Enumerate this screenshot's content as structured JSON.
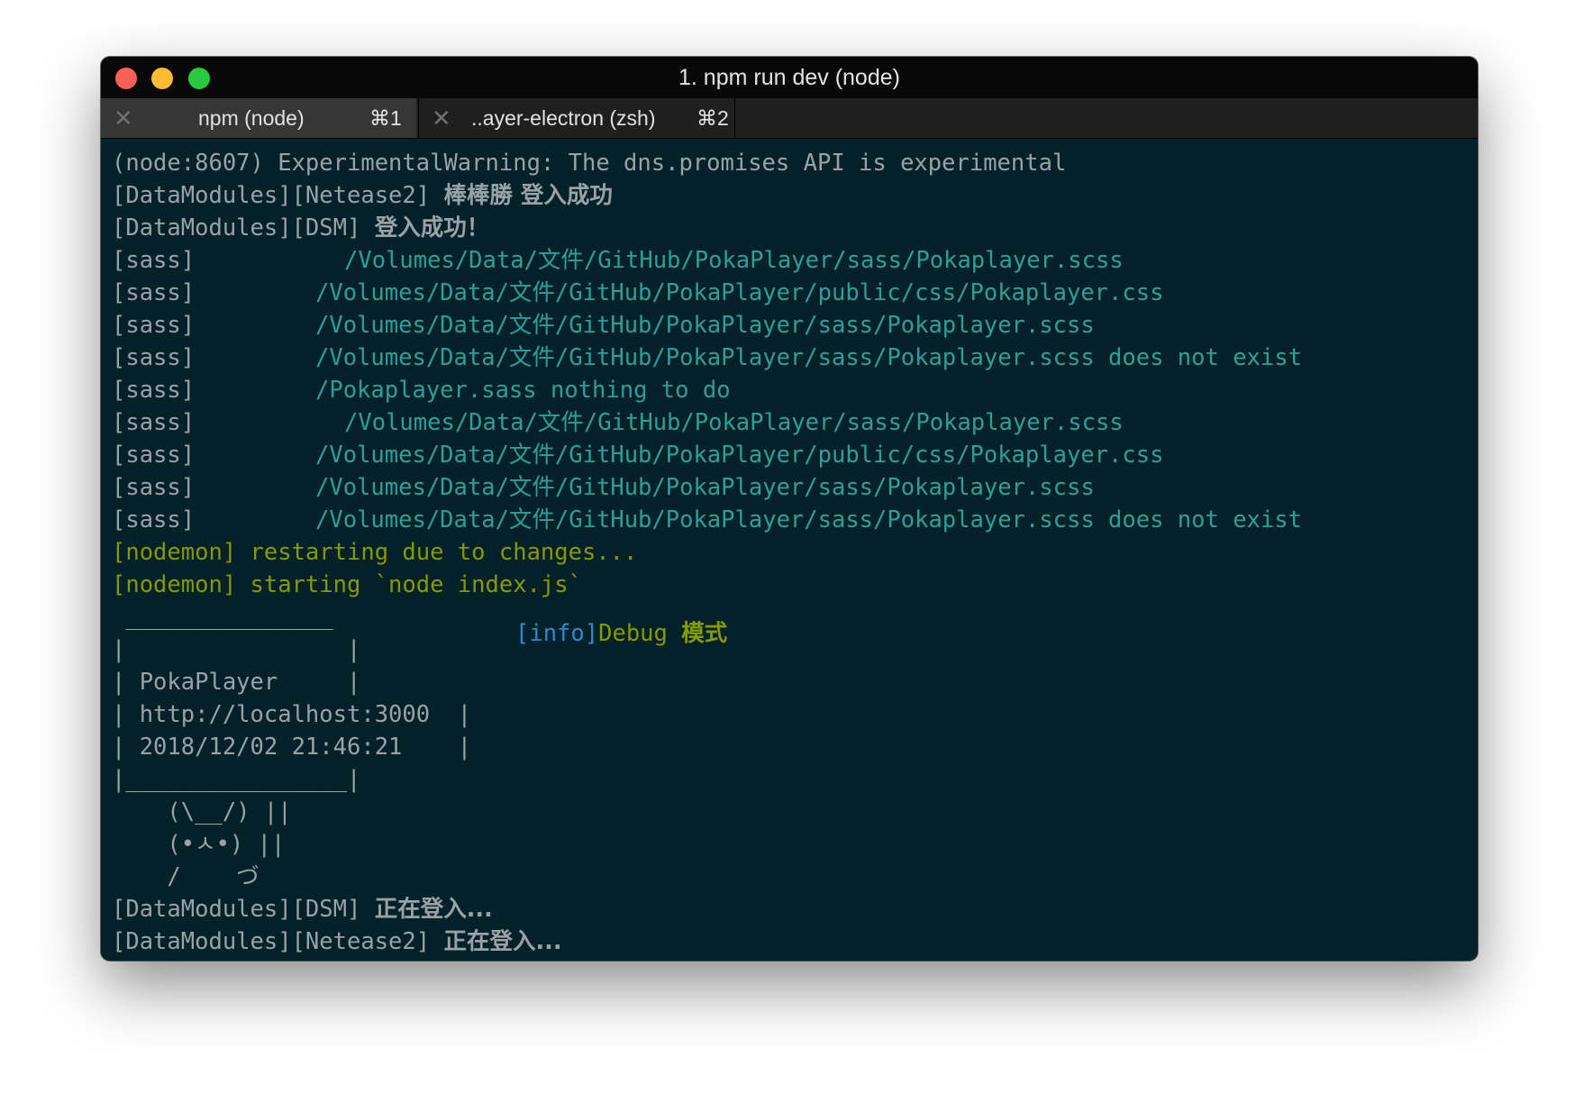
{
  "window": {
    "title": "1. npm run dev (node)"
  },
  "tabs": [
    {
      "label": "npm (node)",
      "shortcut": "⌘1",
      "active": true
    },
    {
      "label": "..ayer-electron (zsh)",
      "shortcut": "⌘2",
      "active": false
    }
  ],
  "terminal": {
    "line1": "(node:8607) ExperimentalWarning: The dns.promises API is experimental",
    "line2_tag": "[DataModules][Netease2] ",
    "line2_msg": "棒棒勝 登入成功",
    "line3_tag": "[DataModules][DSM] ",
    "line3_msg": "登入成功！",
    "sass_tag": "[sass]",
    "sass1": "/Volumes/Data/文件/GitHub/PokaPlayer/sass/Pokaplayer.scss",
    "sass2": "/Volumes/Data/文件/GitHub/PokaPlayer/public/css/Pokaplayer.css",
    "sass3": "/Volumes/Data/文件/GitHub/PokaPlayer/sass/Pokaplayer.scss",
    "sass4": "/Volumes/Data/文件/GitHub/PokaPlayer/sass/Pokaplayer.scss does not exist",
    "sass5": "/Pokaplayer.sass nothing to do",
    "sass6": "/Volumes/Data/文件/GitHub/PokaPlayer/sass/Pokaplayer.scss",
    "sass7": "/Volumes/Data/文件/GitHub/PokaPlayer/public/css/Pokaplayer.css",
    "sass8": "/Volumes/Data/文件/GitHub/PokaPlayer/sass/Pokaplayer.scss",
    "sass9": "/Volumes/Data/文件/GitHub/PokaPlayer/sass/Pokaplayer.scss does not exist",
    "nodemon1": "[nodemon] restarting due to changes...",
    "nodemon2": "[nodemon] starting `node index.js`",
    "box_top": " _______________",
    "box_l1": "|                |",
    "box_l2": "| PokaPlayer     |",
    "box_l3": "| http://localhost:3000  |",
    "box_l4": "| 2018/12/02 21:46:21    |",
    "box_bottom": "|________________|",
    "info_tag": "[info]",
    "info_msg": "Debug ",
    "info_cjk": "模式",
    "art1": "    (\\__/) ||",
    "art2": "    (•ㅅ•) ||",
    "art3": "    /    づ",
    "last1_tag": "[DataModules][DSM] ",
    "last1_msg": "正在登入...",
    "last2_tag": "[DataModules][Netease2] ",
    "last2_msg": "正在登入..."
  }
}
